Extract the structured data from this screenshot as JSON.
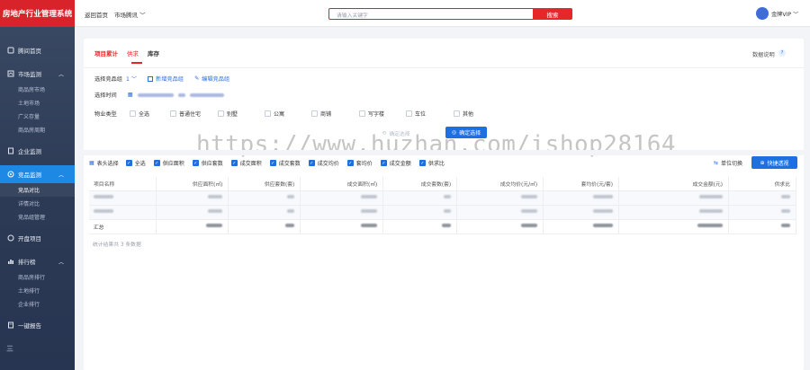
{
  "app": {
    "title": "房地产行业管理系统"
  },
  "sidebar": {
    "items": [
      {
        "label": "腾间首页",
        "icon": "home-icon",
        "type": "group"
      },
      {
        "label": "市场监测",
        "icon": "chart-icon",
        "type": "group",
        "expanded": true
      },
      {
        "label": "商品房市场",
        "type": "sub"
      },
      {
        "label": "土地市场",
        "type": "sub"
      },
      {
        "label": "广义存量",
        "type": "sub"
      },
      {
        "label": "商品房周期",
        "type": "sub"
      },
      {
        "label": "企业监测",
        "icon": "building-icon",
        "type": "group"
      },
      {
        "label": "竞品监测",
        "icon": "target-icon",
        "type": "group",
        "active": true,
        "expanded": true
      },
      {
        "label": "竞品对比",
        "type": "sub",
        "active": true
      },
      {
        "label": "详情对比",
        "type": "sub"
      },
      {
        "label": "竞品组管理",
        "type": "sub"
      },
      {
        "label": "开盘项目",
        "icon": "flag-icon",
        "type": "group"
      },
      {
        "label": "排行榜",
        "icon": "rank-icon",
        "type": "group",
        "expanded": true
      },
      {
        "label": "商品房排行",
        "type": "sub"
      },
      {
        "label": "土地排行",
        "type": "sub"
      },
      {
        "label": "企业排行",
        "type": "sub"
      },
      {
        "label": "一键报告",
        "icon": "report-icon",
        "type": "group"
      }
    ],
    "collapse_glyph": "三"
  },
  "topbar": {
    "home": "返回首页",
    "market": "市场腾讯",
    "search_placeholder": "请输入关键字",
    "search_button": "搜索",
    "user": "金牌VIP"
  },
  "tabs": {
    "t1": "项目累计",
    "t2": "供求",
    "t3": "库存"
  },
  "data_note": "数据说明",
  "filters": {
    "group_label": "选择竞品组",
    "group_value": "1",
    "add_group": "新增竞品组",
    "edit_group": "编辑竞品组",
    "time_label": "选择时间",
    "property_label": "物业类型",
    "property_types": [
      "全选",
      "普通住宅",
      "别墅",
      "公寓",
      "商铺",
      "写字楼",
      "车位",
      "其他"
    ],
    "cancel": "确定选择",
    "confirm": "确定选择"
  },
  "watermark": "https://www.huzhan.com/ishop28164",
  "columns_bar": {
    "label": "表头选择",
    "options": [
      "全选",
      "供应面积",
      "供应套数",
      "成交面积",
      "成交套数",
      "成交均价",
      "套均价",
      "成交金额",
      "供求比"
    ]
  },
  "unit_switch": "单位切换",
  "quick_export": "快捷透视",
  "table": {
    "headers": [
      "项目名称",
      "供应面积(㎡)",
      "供应套数(套)",
      "成交面积(㎡)",
      "成交套数(套)",
      "成交均价(元/㎡)",
      "套均价(元/套)",
      "成交金额(元)",
      "供求比"
    ],
    "summary_label": "汇总"
  },
  "footnote": "统计结果共 3 条数据",
  "colors": {
    "brand_red": "#d8232a",
    "accent_blue": "#1e6fe0",
    "sidebar_bg": "#2c3a55"
  }
}
